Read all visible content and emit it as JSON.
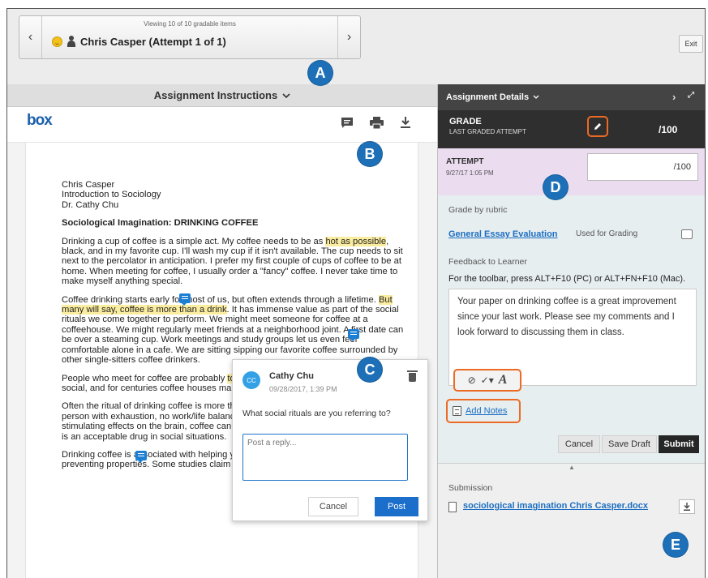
{
  "nav": {
    "viewing": "Viewing 10 of 10 gradable items",
    "student": "Chris Casper (Attempt 1 of 1)",
    "prev_icon": "chevron-left-icon",
    "next_icon": "chevron-right-icon",
    "exit_label": "Exit"
  },
  "badges": {
    "a": "A",
    "b": "B",
    "c": "C",
    "d": "D",
    "e": "E"
  },
  "instructions": {
    "title": "Assignment Instructions",
    "logo": "box"
  },
  "document": {
    "header_lines": [
      "Chris Casper",
      "Introduction to Sociology",
      "Dr. Cathy Chu"
    ],
    "heading": "Sociological Imagination: DRINKING COFFEE",
    "p1_a": "Drinking a cup of coffee is a simple act. My coffee needs to be as ",
    "p1_hl": "hot as possible",
    "p1_b": ", black, and in my favorite cup. I'll wash my cup if it isn't available. The cup needs to sit next to the percolator in anticipation. I prefer my first couple of cups of coffee to be at home. When meeting for coffee, I usually order a \"fancy\" coffee. I never take time to make myself anything special.",
    "p2_a": "Coffee drinking starts early for most of us, but often extends through a lifetime. ",
    "p2_hl": "But many will say, coffee is more than a drink",
    "p2_b": ". It has immense value as part of the social rituals we come together to perform. We might meet someone for coffee at a coffeehouse. We might regularly meet friends at a neighborhood joint. A first date can be over a steaming cup. Work meetings and study groups let us even feel comfortable alone in a cafe. We are sitting sipping our favorite coffee surrounded by other single-sitters coffee drinkers.",
    "p3_a": "People who meet for coffee are probably ",
    "p3_hl": "together",
    "p3_b": " and chatting than in what is highly social, and for centuries coffee houses make their businesses centers of community.",
    "p4": "Often the ritual of drinking coffee is more than consuming the coffee itself. For a person with exhaustion, no work/life balance, a cup is a quick fix. Because of its stimulating effects on the brain, coffee can be considered a drug. Like alcohol, coffee is an acceptable drug in social situations.",
    "p5": "Drinking coffee is associated with helping your health, as it may have cancer-preventing properties. Some studies claim caffeine helps your"
  },
  "comment": {
    "initials": "CC",
    "author": "Cathy Chu",
    "date": "09/28/2017, 1:39 PM",
    "text": "What social rituals are you referring to?",
    "reply_placeholder": "Post a reply...",
    "cancel": "Cancel",
    "post": "Post"
  },
  "details": {
    "title": "Assignment Details",
    "grade_label": "GRADE",
    "grade_sub": "LAST GRADED ATTEMPT",
    "grade_score": "/100",
    "attempt_label": "ATTEMPT",
    "attempt_date": "9/27/17 1:05 PM",
    "attempt_score": "/100",
    "grade_by_rubric": "Grade by rubric",
    "rubric_name": "General Essay Evaluation",
    "rubric_used": "Used for Grading",
    "feedback_label": "Feedback to Learner",
    "toolbar_hint": "For the toolbar, press ALT+F10 (PC) or ALT+FN+F10 (Mac).",
    "feedback_text": "Your paper on drinking coffee is a great improvement since your last work. Please see my comments and I look forward to discussing them in class.",
    "add_notes": "Add Notes",
    "cancel": "Cancel",
    "save_draft": "Save Draft",
    "submit": "Submit",
    "submission_label": "Submission",
    "file_name": "sociological imagination Chris Casper.docx"
  },
  "colors": {
    "callout": "#1d70b8",
    "highlight_outline": "#ec6a23",
    "link": "#1c6ec2",
    "attempt_bg": "#ebdcf0"
  }
}
